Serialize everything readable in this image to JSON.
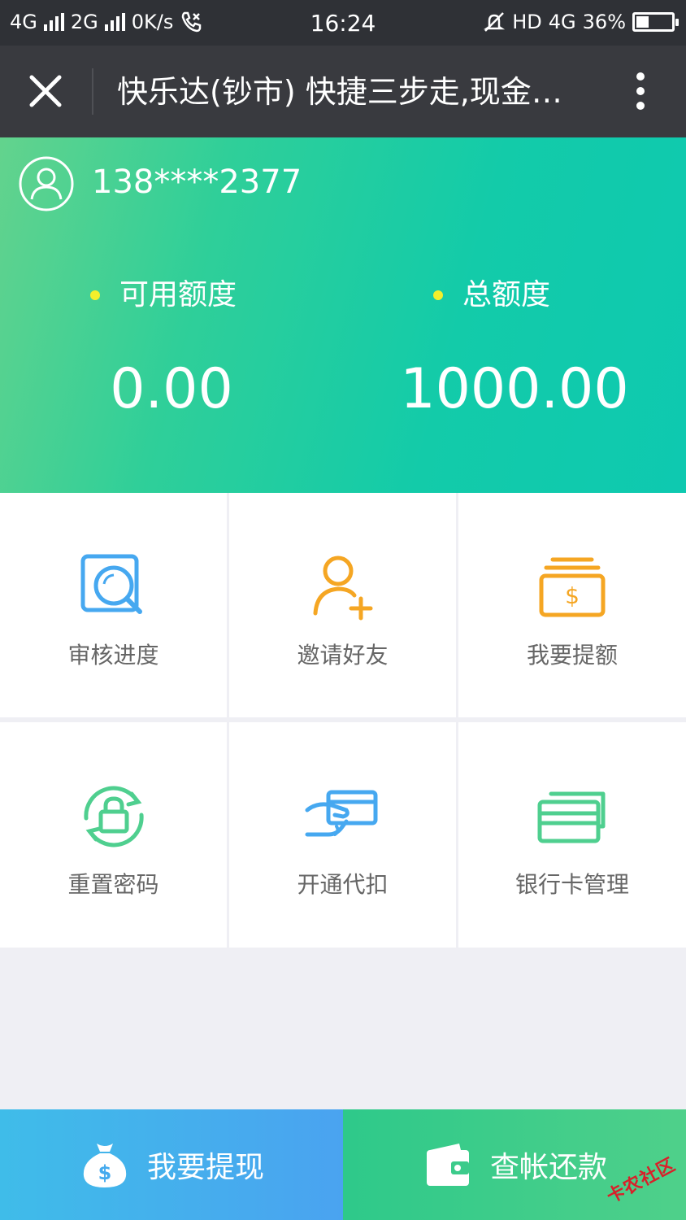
{
  "status_bar": {
    "network1": "4G",
    "network2": "2G",
    "speed": "0K/s",
    "time": "16:24",
    "hd": "HD",
    "network3": "4G",
    "battery": "36%",
    "battery_level": 0.36
  },
  "nav": {
    "title": "快乐达(钞市) 快捷三步走,现金借款"
  },
  "account": {
    "phone": "138****2377"
  },
  "credit": {
    "available_label": "可用额度",
    "available_value": "0.00",
    "total_label": "总额度",
    "total_value": "1000.00"
  },
  "grid": [
    {
      "label": "审核进度",
      "icon": "review-search-icon"
    },
    {
      "label": "邀请好友",
      "icon": "invite-user-icon"
    },
    {
      "label": "我要提额",
      "icon": "money-stack-icon"
    },
    {
      "label": "重置密码",
      "icon": "lock-reset-icon"
    },
    {
      "label": "开通代扣",
      "icon": "hand-card-icon"
    },
    {
      "label": "银行卡管理",
      "icon": "bank-cards-icon"
    }
  ],
  "bottom": {
    "withdraw_label": "我要提现",
    "repay_label": "查帐还款"
  },
  "watermark": "卡农社区",
  "colors": {
    "header_start": "#63d38d",
    "header_end": "#0ec9b0",
    "blue_icon": "#46a8f0",
    "orange_icon": "#f5a623",
    "green_icon": "#4fcf8f"
  }
}
